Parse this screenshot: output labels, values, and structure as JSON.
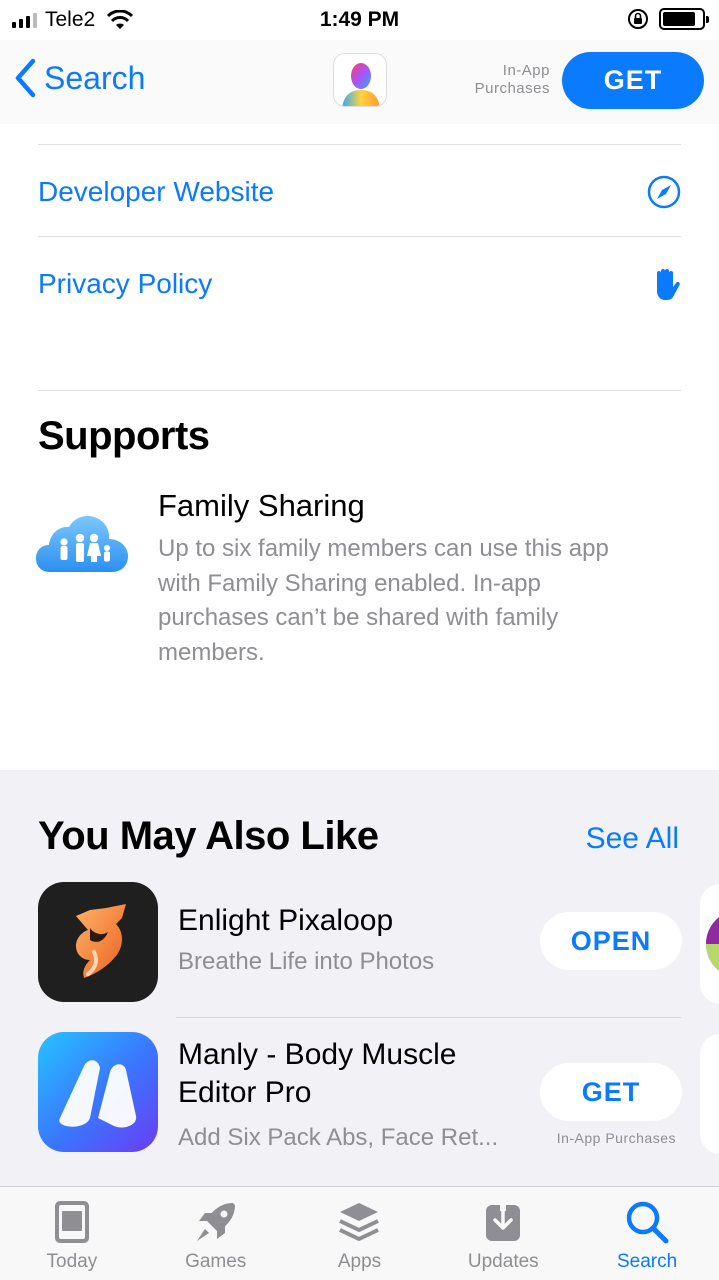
{
  "status_bar": {
    "carrier": "Tele2",
    "time": "1:49 PM"
  },
  "nav": {
    "back_label": "Search",
    "in_app_line1": "In-App",
    "in_app_line2": "Purchases",
    "get_label": "GET"
  },
  "links": {
    "developer_website": "Developer Website",
    "privacy_policy": "Privacy Policy"
  },
  "supports": {
    "title": "Supports",
    "family_title": "Family Sharing",
    "family_description": "Up to six family members can use this app with Family Sharing enabled. In-app purchases can’t be shared with family members."
  },
  "also_like": {
    "title": "You May Also Like",
    "see_all": "See All",
    "apps": [
      {
        "name": "Enlight Pixaloop",
        "subtitle": "Breathe Life into Photos",
        "button": "OPEN"
      },
      {
        "name_line1": "Manly - Body Muscle",
        "name_line2": "Editor Pro",
        "subtitle": "Add Six Pack Abs, Face Ret...",
        "button": "GET",
        "in_app": "In-App Purchases"
      }
    ]
  },
  "tabs": [
    {
      "label": "Today",
      "icon": "today-icon"
    },
    {
      "label": "Games",
      "icon": "rocket-icon"
    },
    {
      "label": "Apps",
      "icon": "layers-icon"
    },
    {
      "label": "Updates",
      "icon": "download-icon"
    },
    {
      "label": "Search",
      "icon": "search-icon"
    }
  ],
  "colors": {
    "accent": "#0a7aff",
    "secondary_text": "#8e8e93",
    "section_background": "#f1f1f6"
  }
}
